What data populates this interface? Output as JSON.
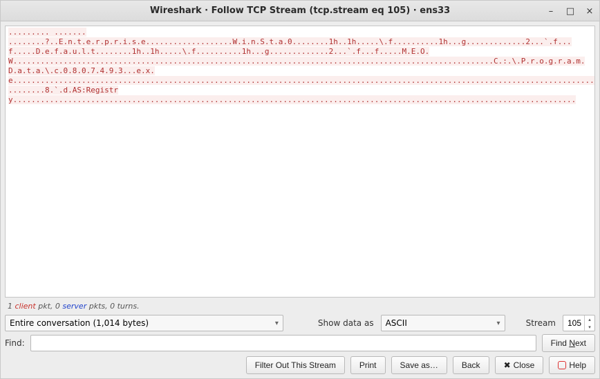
{
  "window": {
    "title": "Wireshark · Follow TCP Stream (tcp.stream eq 105) · ens33"
  },
  "stream": {
    "client_text": "......... .......\n........?..E.n.t.e.r.p.r.i.s.e...................W.i.n.S.t.a.0........1h..1h.....\\.f..........1h...g.............2...`.f...f.....D.e.f.a.u.l.t........1h..1h.....\\.f..........1h...g.............2...`.f...f.....M.E.O.W.........................................................................................................C.:.\\.P.r.o.g.r.a.m.D.a.t.a.\\.c.0.8.0.7.4.9.3...e.x.e............................................................................................................................................................................................................................................................................................................................................................................................................ ........8.`.d.AS:Registry..........................................................................................................................."
  },
  "status": {
    "client_pkts_num": "1",
    "client_label": "client",
    "server_pkts_num": "0",
    "server_label": "server",
    "turns_text": "pkts, 0 turns."
  },
  "filters": {
    "conversation": "Entire conversation (1,014 bytes)",
    "show_data_label": "Show data as",
    "show_data_value": "ASCII",
    "stream_label": "Stream",
    "stream_value": "105"
  },
  "find": {
    "label": "Find:",
    "value": "",
    "button": "Find Next"
  },
  "buttons": {
    "filter_out": "Filter Out This Stream",
    "print": "Print",
    "save_as": "Save as…",
    "back": "Back",
    "close": "Close",
    "help": "Help"
  }
}
